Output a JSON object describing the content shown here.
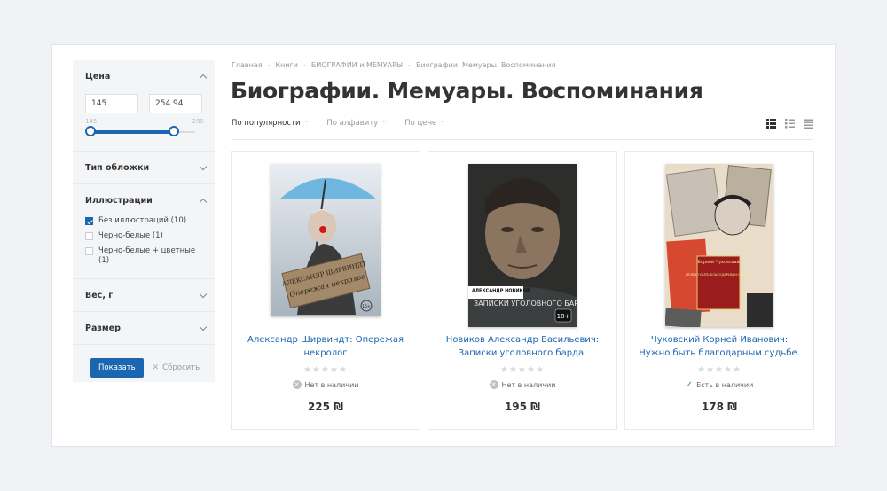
{
  "filters": {
    "price": {
      "title": "Цена",
      "min_value": "145",
      "max_value": "254.94",
      "range_min_label": "145",
      "range_max_label": "285",
      "slider_low": 145,
      "slider_high": 254.94
    },
    "cover_type": {
      "title": "Тип обложки"
    },
    "illustrations": {
      "title": "Иллюстрации",
      "options": [
        {
          "label": "Без иллюстраций (10)",
          "checked": true
        },
        {
          "label": "Черно-белые (1)",
          "checked": false
        },
        {
          "label": "Черно-белые + цветные (1)",
          "checked": false
        }
      ]
    },
    "weight": {
      "title": "Вес, г"
    },
    "size": {
      "title": "Размер"
    },
    "show_button": "Показать",
    "reset_label": "Сбросить"
  },
  "breadcrumb": [
    "Главная",
    "Книги",
    "БИОГРАФИИ и МЕМУАРЫ",
    "Биографии. Мемуары. Воспоминания"
  ],
  "page_title": "Биографии. Мемуары. Воспоминания",
  "sort": [
    {
      "label": "По популярности",
      "active": true
    },
    {
      "label": "По алфавиту",
      "active": false
    },
    {
      "label": "По цене",
      "active": false
    }
  ],
  "view_modes": [
    "grid-view-icon",
    "list-view-icon",
    "compact-list-icon"
  ],
  "products": [
    {
      "title": "Александр Ширвиндт: Опережая некролог",
      "stars": "★★★★★",
      "stock": "Нет в наличии",
      "in_stock": false,
      "price": "225 ₪",
      "cover_author": "АЛЕКСАНДР ШИРВИНДТ",
      "cover_name": "Опережая некролог",
      "cover_age": "16+"
    },
    {
      "title": "Новиков Александр Васильевич: Записки уголовного барда.",
      "stars": "★★★★★",
      "stock": "Нет в наличии",
      "in_stock": false,
      "price": "195 ₪",
      "cover_author": "АЛЕКСАНДР НОВИКОВ",
      "cover_name": "ЗАПИСКИ УГОЛОВНОГО БАРДА",
      "cover_age": "18+"
    },
    {
      "title": "Чуковский Корней Иванович: Нужно быть благодарным судьбе.",
      "stars": "★★★★★",
      "stock": "Есть в наличии",
      "in_stock": true,
      "price": "178 ₪",
      "cover_author": "Корней Чуковский",
      "cover_name": "НУЖНО БЫТЬ БЛАГОДАРНЫМ СУДЬБЕ"
    }
  ]
}
